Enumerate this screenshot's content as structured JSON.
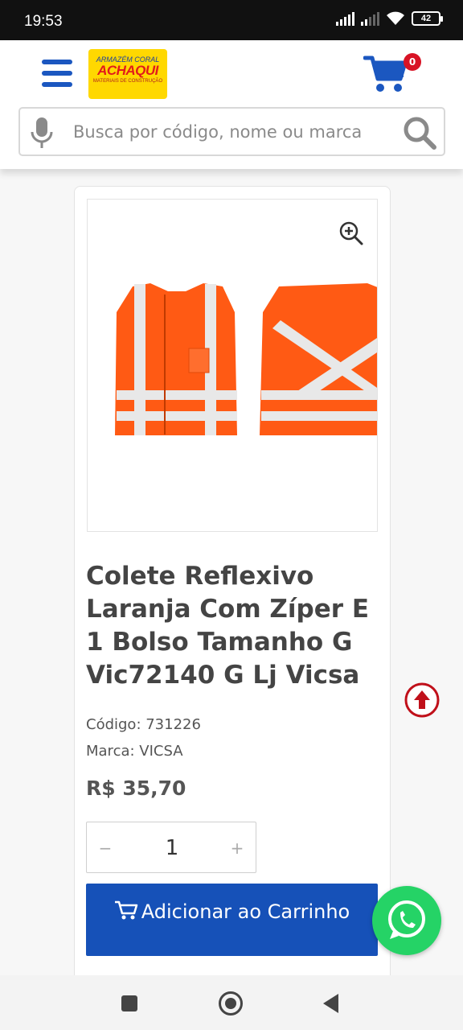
{
  "status_bar": {
    "time": "19:53",
    "battery": "42"
  },
  "header": {
    "logo": {
      "line1": "ARMAZÉM CORAL",
      "line2": "ACHAQUI",
      "line3": "MATERIAIS DE CONSTRUÇÃO"
    },
    "cart_count": "0",
    "search_placeholder": "Busca por código, nome ou marca"
  },
  "product": {
    "title": "Colete Reflexivo Laranja Com Zíper E 1 Bolso Tamanho G Vic72140 G Lj Vicsa",
    "code_label": "Código: 731226",
    "brand_label": "Marca: VICSA",
    "price": "R$ 35,70",
    "quantity": "1",
    "minus": "−",
    "plus": "+",
    "add_to_cart": "Adicionar ao Carrinho"
  },
  "colors": {
    "brand_blue": "#1651b8",
    "badge_red": "#d81325",
    "vest_orange": "#ff5a14",
    "whatsapp_green": "#25d366"
  },
  "icons": [
    "menu-icon",
    "cart-icon",
    "microphone-icon",
    "search-icon",
    "zoom-in-icon",
    "arrow-up-icon",
    "whatsapp-icon"
  ]
}
